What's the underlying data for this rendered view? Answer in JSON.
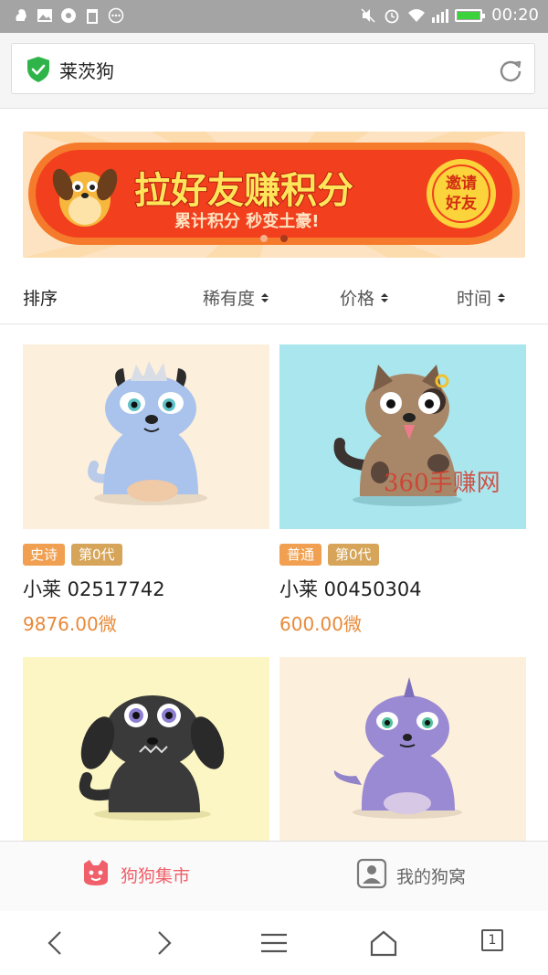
{
  "status_bar": {
    "time": "00:20",
    "left_icons": [
      "squirrel-icon",
      "image-icon",
      "aperture-icon",
      "trash-icon",
      "more-dots-icon"
    ],
    "right_icons": [
      "mute-icon",
      "alarm-icon",
      "wifi-icon",
      "signal-icon",
      "battery-icon"
    ],
    "battery_level": 1.0
  },
  "address_bar": {
    "title": "莱茨狗",
    "secure_icon": "shield-check-icon",
    "refresh_icon": "refresh-icon"
  },
  "banner": {
    "headline": "拉好友赚积分",
    "subline": "累计积分 秒变土豪!",
    "button_line1": "邀请",
    "button_line2": "好友"
  },
  "sort_bar": {
    "label": "排序",
    "options": [
      {
        "label": "稀有度"
      },
      {
        "label": "价格"
      },
      {
        "label": "时间"
      }
    ]
  },
  "listings": [
    {
      "rarity": "史诗",
      "generation": "第0代",
      "name": "小莱 02517742",
      "price": "9876.00微",
      "bg": "#fcefdc"
    },
    {
      "rarity": "普通",
      "generation": "第0代",
      "name": "小莱 00450304",
      "price": "600.00微",
      "bg": "#a9e6ee"
    },
    {
      "bg": "#fcf6c4"
    },
    {
      "bg": "#fcefdc"
    }
  ],
  "watermark": "360手赚网",
  "tab_bar": {
    "market_label": "狗狗集市",
    "mine_label": "我的狗窝"
  },
  "browser_nav": {
    "tab_count": "1"
  },
  "colors": {
    "accent_price": "#e88a3a",
    "tag_rarity": "#f0a050",
    "tag_gen": "#d6a55a",
    "tab_active": "#f0606a"
  }
}
